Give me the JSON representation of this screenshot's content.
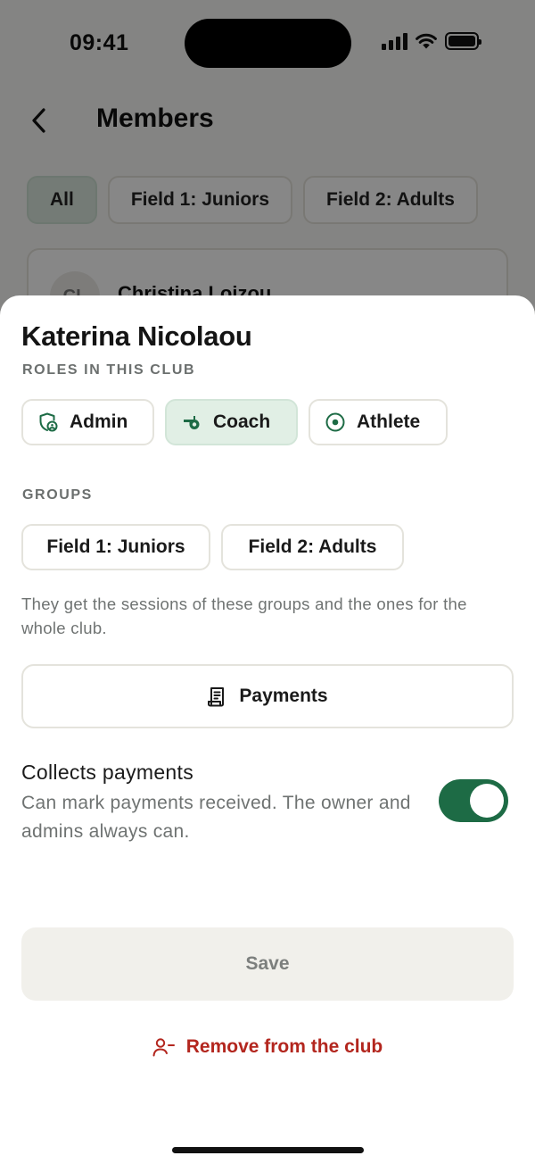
{
  "status_bar": {
    "time": "09:41"
  },
  "header": {
    "title": "Members"
  },
  "filters": [
    {
      "label": "All",
      "active": true
    },
    {
      "label": "Field 1: Juniors",
      "active": false
    },
    {
      "label": "Field 2: Adults",
      "active": false
    }
  ],
  "member_preview": {
    "initials": "CL",
    "name": "Christina Loizou"
  },
  "sheet": {
    "person_name": "Katerina Nicolaou",
    "roles_label": "ROLES IN THIS CLUB",
    "roles": [
      {
        "label": "Admin",
        "icon": "shield-user-icon",
        "selected": false
      },
      {
        "label": "Coach",
        "icon": "whistle-icon",
        "selected": true
      },
      {
        "label": "Athlete",
        "icon": "target-icon",
        "selected": false
      }
    ],
    "groups_label": "GROUPS",
    "groups": [
      "Field 1: Juniors",
      "Field 2: Adults"
    ],
    "groups_help": "They get the sessions of these groups and the ones for the whole club.",
    "payments_button": {
      "label": "Payments",
      "icon": "receipt-icon"
    },
    "collects_payments": {
      "title": "Collects payments",
      "description": "Can mark payments received. The owner and admins always can.",
      "enabled": true
    },
    "save_label": "Save",
    "remove_label": "Remove from the club"
  },
  "colors": {
    "accent": "#1d6b45",
    "selected_bg": "#e1efe5",
    "danger": "#b3261e",
    "save_bg": "#f1f0eb"
  }
}
